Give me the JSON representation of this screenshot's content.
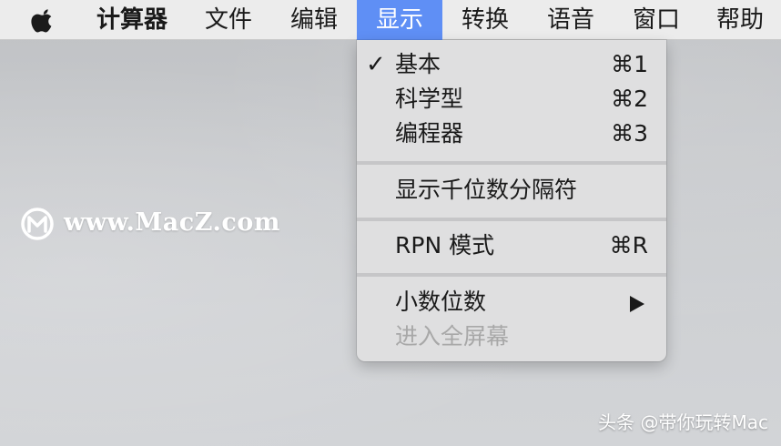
{
  "menubar": {
    "apple_icon": "apple-logo-icon",
    "app_name": "计算器",
    "menus": [
      "文件",
      "编辑",
      "显示",
      "转换",
      "语音",
      "窗口",
      "帮助"
    ],
    "active_menu": "显示",
    "active_color": "#5f8ff5"
  },
  "display_menu": {
    "view_mode_items": [
      {
        "label": "基本",
        "shortcut": "⌘1",
        "checked": true,
        "check_mark": "✓"
      },
      {
        "label": "科学型",
        "shortcut": "⌘2",
        "checked": false
      },
      {
        "label": "编程器",
        "shortcut": "⌘3",
        "checked": false
      }
    ],
    "thousands_separator": {
      "label": "显示千位数分隔符"
    },
    "rpn_mode": {
      "label": "RPN 模式",
      "shortcut": "⌘R"
    },
    "decimal_places": {
      "label": "小数位数",
      "has_submenu": true,
      "icon": "submenu-arrow-icon"
    },
    "enter_full_screen": {
      "label": "进入全屏幕",
      "enabled": false
    }
  },
  "watermarks": {
    "site_logo": "macz-logo-icon",
    "site_text": "www.MacZ.com",
    "bottom_text": "头条 @带你玩转Mac"
  }
}
